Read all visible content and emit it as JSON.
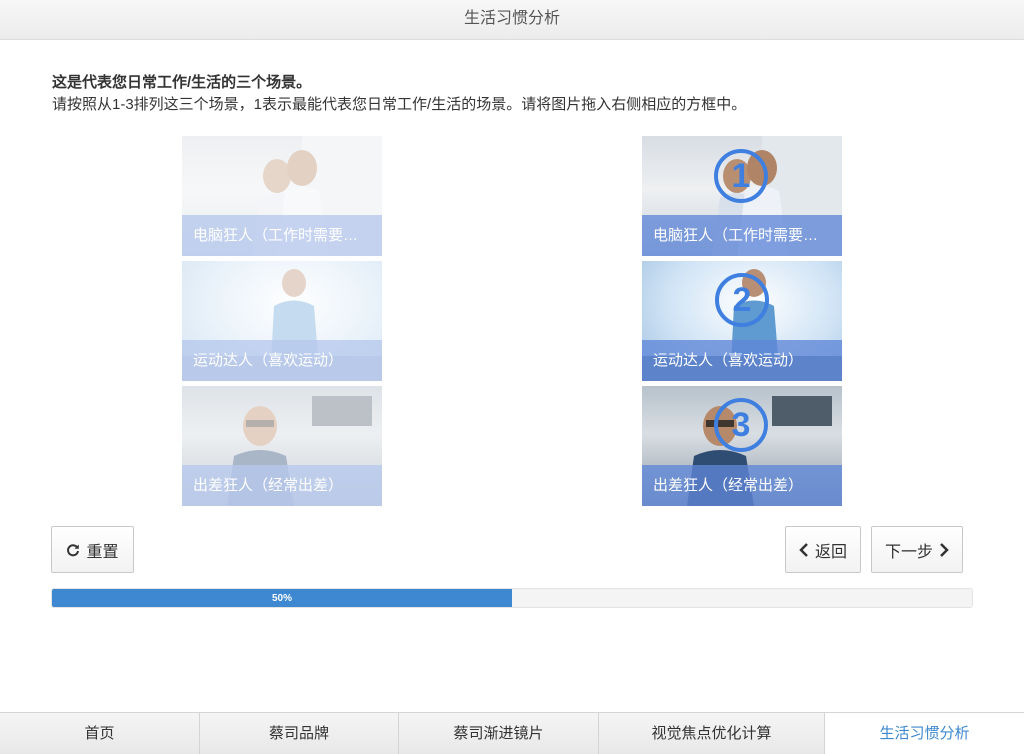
{
  "window": {
    "title": "生活习惯分析"
  },
  "instructions": {
    "heading": "这是代表您日常工作/生活的三个场景。",
    "text": "请按照从1-3排列这三个场景，1表示最能代表您日常工作/生活的场景。请将图片拖入右侧相应的方框中。"
  },
  "source_cards": [
    {
      "label": "电脑狂人（工作时需要…"
    },
    {
      "label": "运动达人（喜欢运动）"
    },
    {
      "label": "出差狂人（经常出差）"
    }
  ],
  "ranked_slots": [
    {
      "rank": "1",
      "label": "电脑狂人（工作时需要…"
    },
    {
      "rank": "2",
      "label": "运动达人（喜欢运动）"
    },
    {
      "rank": "3",
      "label": "出差狂人（经常出差）"
    }
  ],
  "buttons": {
    "reset": "重置",
    "back": "返回",
    "next": "下一步"
  },
  "progress": {
    "value": 0.5,
    "label": "50%"
  },
  "bottom_nav": {
    "tabs": [
      {
        "label": "首页"
      },
      {
        "label": "蔡司品牌"
      },
      {
        "label": "蔡司渐进镜片"
      },
      {
        "label": "视觉焦点优化计算"
      },
      {
        "label": "生活习惯分析"
      }
    ]
  },
  "colors": {
    "accent": "#3d88d0",
    "badge": "#3f7fe0",
    "caption_overlay": "#5f87d7"
  },
  "icons": {
    "reset": "refresh-icon",
    "back": "chevron-left-icon",
    "next": "chevron-right-icon"
  }
}
